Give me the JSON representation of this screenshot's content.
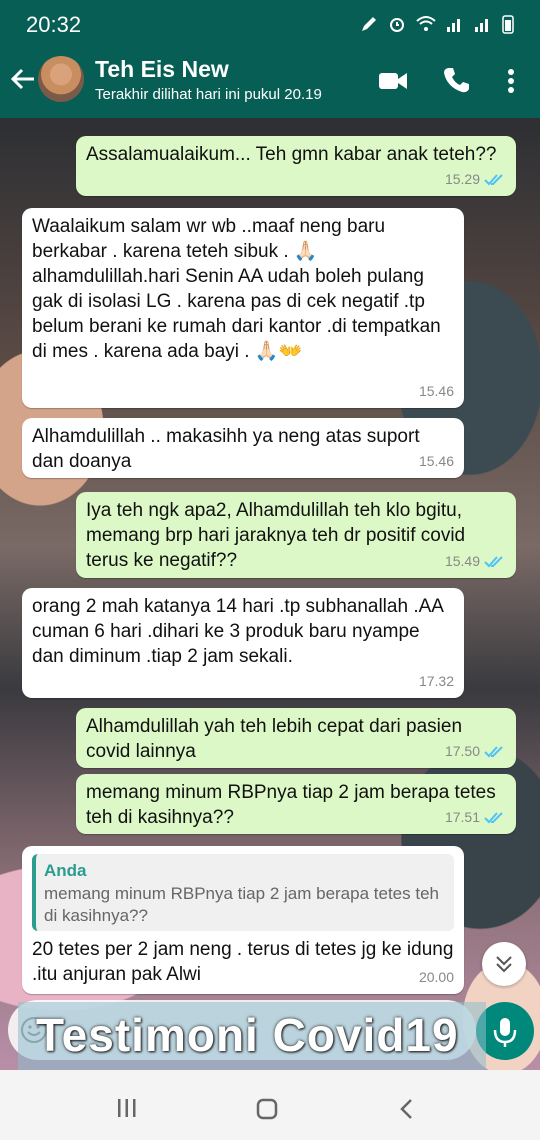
{
  "status_bar": {
    "time": "20:32"
  },
  "header": {
    "contact_name": "Teh Eis New",
    "last_seen": "Terakhir dilihat hari ini pukul 20.19"
  },
  "messages": [
    {
      "direction": "out",
      "text": "Assalamualaikum... Teh gmn kabar anak teteh??",
      "time": "15.29",
      "read": true
    },
    {
      "direction": "in",
      "text": "Waalaikum salam wr wb ..maaf neng baru berkabar . karena teteh sibuk . 🙏🏻 alhamdulillah.hari Senin AA udah boleh pulang gak di isolasi LG . karena pas di cek negatif .tp belum berani ke rumah dari kantor .di tempatkan di mes . karena ada bayi . 🙏🏻👐",
      "time": "15.46"
    },
    {
      "direction": "in",
      "text": "Alhamdulillah .. makasihh ya neng atas suport dan doanya",
      "time": "15.46"
    },
    {
      "direction": "out",
      "text": "Iya teh ngk apa2, Alhamdulillah teh klo bgitu, memang brp hari jaraknya teh dr positif covid terus ke negatif??",
      "time": "15.49",
      "read": true
    },
    {
      "direction": "in",
      "text": "orang 2 mah katanya 14 hari .tp subhanallah .AA cuman 6 hari .dihari ke 3 produk baru nyampe dan diminum .tiap 2 jam sekali.",
      "time": "17.32"
    },
    {
      "direction": "out",
      "text": "Alhamdulillah yah teh lebih cepat dari pasien covid lainnya",
      "time": "17.50",
      "read": true
    },
    {
      "direction": "out",
      "text": "memang minum RBPnya tiap 2 jam berapa tetes teh di kasihnya??",
      "time": "17.51",
      "read": true
    },
    {
      "direction": "in",
      "reply_author": "Anda",
      "reply_text": "memang minum RBPnya tiap 2 jam berapa tetes teh di kasihnya??",
      "text": "20 tetes per 2 jam neng . terus di tetes jg ke idung .itu anjuran pak Alwi",
      "time": "20.00"
    }
  ],
  "overlay_caption": "Testimoni Covid19",
  "icons": {
    "back": "arrow-left-icon",
    "video": "video-call-icon",
    "call": "phone-icon",
    "menu": "more-vert-icon",
    "emoji": "emoji-icon",
    "mic": "mic-icon",
    "scroll": "chevron-double-down-icon"
  },
  "colors": {
    "header": "#075e54",
    "outgoing_bubble": "#dcf8c6",
    "incoming_bubble": "#ffffff",
    "read_ticks": "#4fc3f7",
    "mic_button": "#00897b"
  }
}
